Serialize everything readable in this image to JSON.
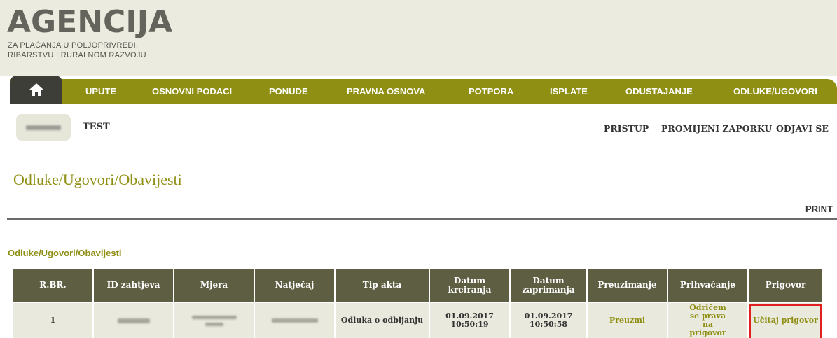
{
  "logo": {
    "title": "AGENCIJA",
    "line1": "ZA PLAĆANJA U POLJOPRIVREDI,",
    "line2": "RIBARSTVU I RURALNOM RAZVOJU"
  },
  "nav": {
    "items": [
      {
        "label": "UPUTE"
      },
      {
        "label": "OSNOVNI PODACI"
      },
      {
        "label": "PONUDE"
      },
      {
        "label": "PRAVNA OSNOVA"
      },
      {
        "label": "POTPORA"
      },
      {
        "label": "ISPLATE"
      },
      {
        "label": "ODUSTAJANJE"
      },
      {
        "label": "ODLUKE/UGOVORI"
      }
    ],
    "home_icon": "home-icon"
  },
  "user": {
    "name": "TEST",
    "links": {
      "pristup": "PRISTUP",
      "promijeni": "PROMIJENI ZAPORKU",
      "odjavi": "ODJAVI SE"
    }
  },
  "page": {
    "title": "Odluke/Ugovori/Obavijesti",
    "print": "PRINT",
    "section_title": "Odluke/Ugovori/Obavijesti"
  },
  "table": {
    "headers": [
      "R.BR.",
      "ID zahtjeva",
      "Mjera",
      "Natječaj",
      "Tip akta",
      "Datum kreiranja",
      "Datum zaprimanja",
      "Preuzimanje",
      "Prihvaćanje",
      "Prigovor"
    ],
    "row": {
      "rbr": "1",
      "tip_akta": "Odluka o odbijanju",
      "datum_kreiranja": "01.09.2017 10:50:19",
      "datum_zaprimanja": "01.09.2017 10:50:58",
      "preuzimanje": "Preuzmi",
      "prihvacanje": "Odričem se prava na prigovor",
      "prigovor": "Učitaj prigovor"
    }
  },
  "colors": {
    "olive": "#8f8f14",
    "header_dark": "#5e5e42",
    "row_bg": "#e9e9dd",
    "highlight": "#e02020"
  }
}
